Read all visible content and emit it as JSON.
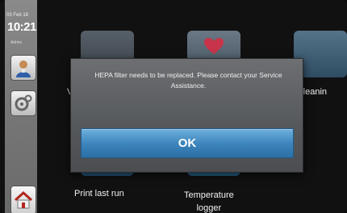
{
  "sidebar": {
    "date": "03 Feb 18",
    "time": "10:21",
    "user": "Admin",
    "buttons": {
      "user_icon": "person-icon",
      "settings_icon": "settings-icon",
      "home_icon": "home-icon"
    }
  },
  "apps": [
    {
      "label": "V",
      "icon": "app-icon"
    },
    {
      "label": "",
      "icon": "heart-icon"
    },
    {
      "label": "p cleanin",
      "icon": "cleaning-icon"
    },
    {
      "label": "Print last run",
      "icon": "print-icon"
    },
    {
      "label": "Temperature\nlogger",
      "icon": "thermometer-icon"
    }
  ],
  "dialog": {
    "message": "HEPA filter needs to be replaced. Please contact your Service Assistance.",
    "ok_label": "OK"
  },
  "colors": {
    "sidebar": "#777777",
    "dialog_bg": "#5a5c5f",
    "ok_button": "#3d86bd"
  }
}
